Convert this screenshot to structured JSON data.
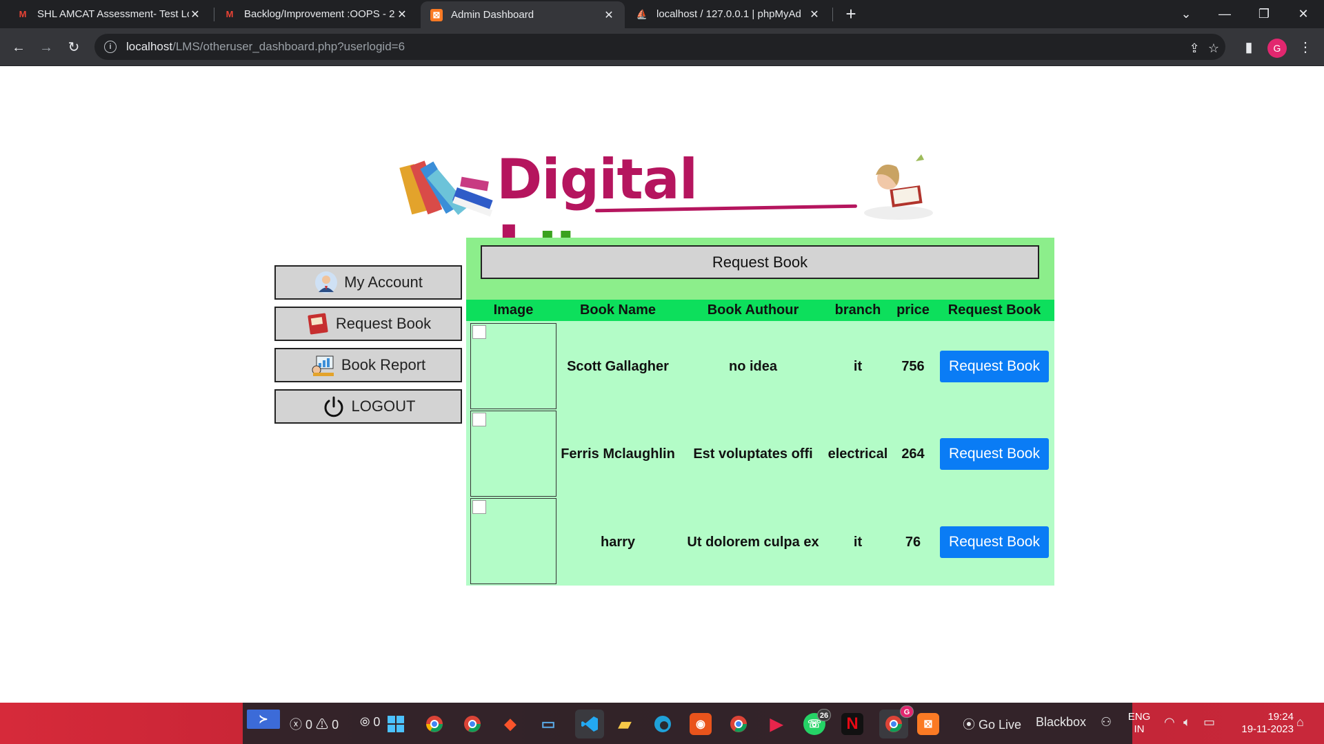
{
  "browser": {
    "tabs": [
      {
        "title": "SHL AMCAT Assessment- Test Lo",
        "favicon": "gmail-icon",
        "active": false
      },
      {
        "title": "Backlog/Improvement :OOPS - 2",
        "favicon": "gmail-icon",
        "active": false
      },
      {
        "title": "Admin Dashboard",
        "favicon": "xampp-icon",
        "active": true
      },
      {
        "title": "localhost / 127.0.0.1 | phpMyAd",
        "favicon": "phpmyadmin-icon",
        "active": false
      }
    ],
    "url_host": "localhost",
    "url_path": "/LMS/otheruser_dashboard.php?userlogid=6",
    "profile_initial": "G"
  },
  "logo": {
    "part1": "Digital ",
    "part2": "L",
    "part3": "ibrary"
  },
  "sidebar": {
    "items": [
      {
        "label": "My Account",
        "icon": "user-avatar-icon"
      },
      {
        "label": "Request Book",
        "icon": "book-icon"
      },
      {
        "label": "Book Report",
        "icon": "report-icon"
      },
      {
        "label": "LOGOUT",
        "icon": "power-icon"
      }
    ]
  },
  "main": {
    "title": "Request Book",
    "columns": [
      "Image",
      "Book Name",
      "Book Authour",
      "branch",
      "price",
      "Request Book"
    ],
    "rows": [
      {
        "name": "Scott Gallagher",
        "author": "no idea",
        "branch": "it",
        "price": "756",
        "action": "Request Book"
      },
      {
        "name": "Ferris Mclaughlin",
        "author": "Est voluptates offi",
        "branch": "electrical",
        "price": "264",
        "action": "Request Book"
      },
      {
        "name": "harry",
        "author": "Ut dolorem culpa ex",
        "branch": "it",
        "price": "76",
        "action": "Request Book"
      }
    ]
  },
  "taskbar": {
    "errors": "0",
    "warnings": "0",
    "ports": "0",
    "whatsapp_badge": "26",
    "chrome_badge": "G",
    "go_live": "Go Live",
    "blackbox": "Blackbox",
    "lang1": "ENG",
    "lang2": "IN",
    "time": "19:24",
    "date": "19-11-2023"
  },
  "colors": {
    "panel_bg": "#b3fcc7",
    "panel_header_bg": "#8cee8b",
    "table_header_bg": "#0ddf5c",
    "button_blue": "#0a7cf5",
    "logo_magenta": "#b5155e",
    "logo_green": "#3aa21f"
  }
}
